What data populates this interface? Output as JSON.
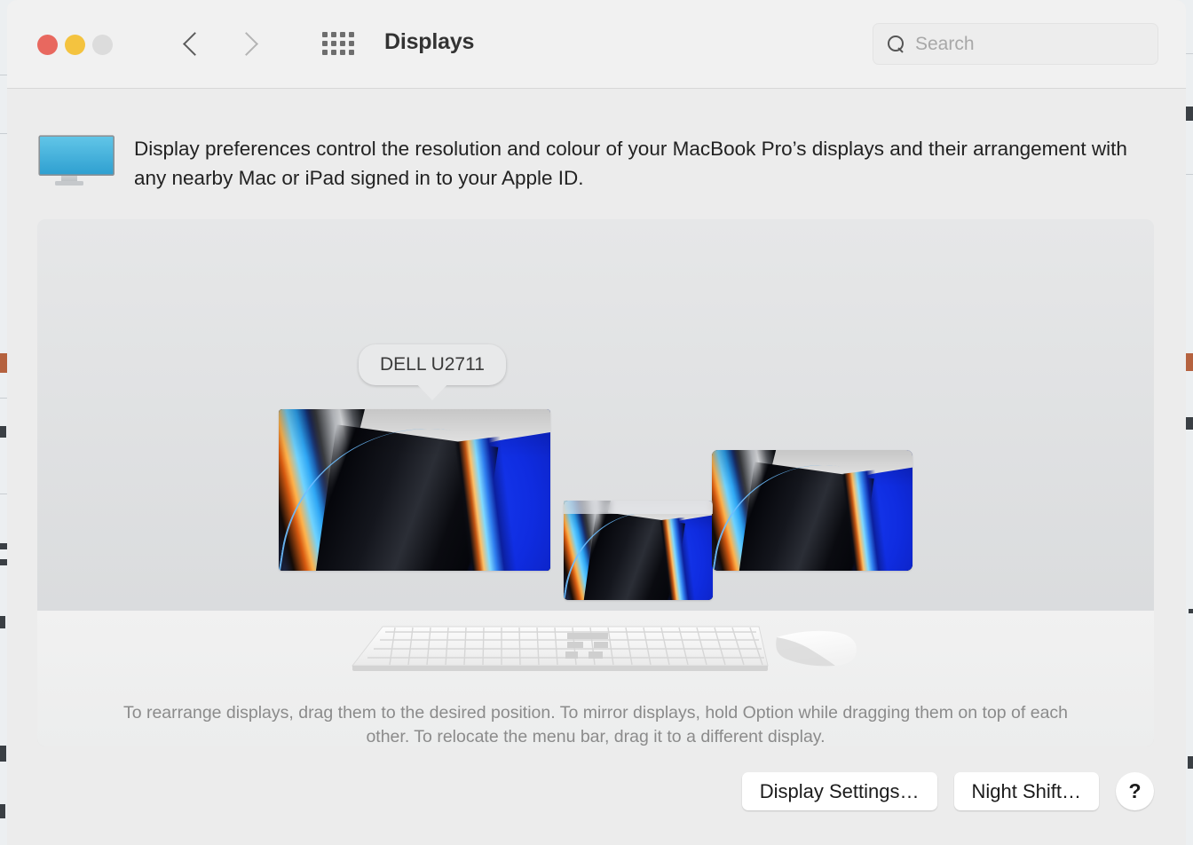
{
  "window": {
    "title": "Displays",
    "traffic_lights": [
      {
        "name": "close",
        "color": "#e8685f"
      },
      {
        "name": "minimize",
        "color": "#f4c33f"
      },
      {
        "name": "zoom",
        "color": "#dcdcdc"
      }
    ],
    "nav": {
      "back_icon": "chevron-left-icon",
      "forward_icon": "chevron-right-icon",
      "grid_icon": "grid-dots-icon"
    }
  },
  "search": {
    "icon": "search-icon",
    "placeholder": "Search",
    "value": ""
  },
  "intro": {
    "icon": "display-monitor-icon",
    "text": "Display preferences control the resolution and colour of your MacBook Pro’s displays and their arrangement with any nearby Mac or iPad signed in to your Apple ID."
  },
  "arrangement": {
    "callout_label": "DELL U2711",
    "displays": [
      {
        "name": "dell-u2711",
        "label": "DELL U2711",
        "has_menubar": false,
        "selected": true
      },
      {
        "name": "built-in",
        "label": "",
        "has_menubar": true,
        "selected": false
      },
      {
        "name": "third-display",
        "label": "",
        "has_menubar": false,
        "selected": false
      }
    ],
    "peripherals": [
      {
        "name": "magic-keyboard-icon"
      },
      {
        "name": "magic-mouse-icon"
      }
    ],
    "hint": "To rearrange displays, drag them to the desired position. To mirror displays, hold Option while dragging them on top of each other. To relocate the menu bar, drag it to a different display."
  },
  "buttons": {
    "display_settings": "Display Settings…",
    "night_shift": "Night Shift…",
    "help": "?"
  },
  "colors": {
    "window_bg": "#ececec",
    "toolbar_bg": "#f1f1f1",
    "panel_top": "#e6e7e8",
    "panel_bottom": "#d6d8da",
    "hint_text": "#8b8b8b",
    "accent_blue": "#1d49ff"
  }
}
